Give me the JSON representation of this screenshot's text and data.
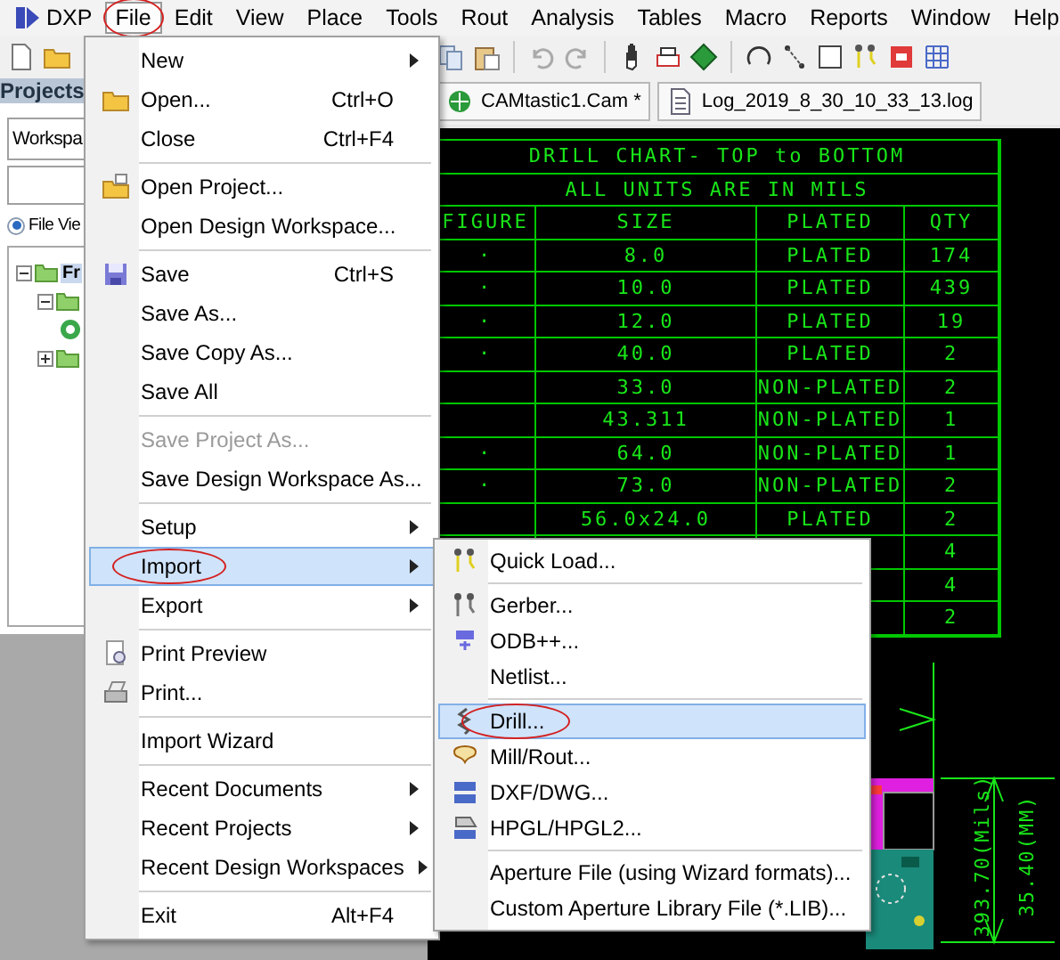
{
  "menubar": [
    {
      "label": "DXP",
      "kind": "logo",
      "selected": false,
      "highlighted": false
    },
    {
      "label": "File",
      "kind": "menu",
      "selected": true,
      "highlighted": true
    },
    {
      "label": "Edit",
      "kind": "menu",
      "selected": false,
      "highlighted": false
    },
    {
      "label": "View",
      "kind": "menu",
      "selected": false,
      "highlighted": false
    },
    {
      "label": "Place",
      "kind": "menu",
      "selected": false,
      "highlighted": false
    },
    {
      "label": "Tools",
      "kind": "menu",
      "selected": false,
      "highlighted": false
    },
    {
      "label": "Rout",
      "kind": "menu",
      "selected": false,
      "highlighted": false
    },
    {
      "label": "Analysis",
      "kind": "menu",
      "selected": false,
      "highlighted": false
    },
    {
      "label": "Tables",
      "kind": "menu",
      "selected": false,
      "highlighted": false
    },
    {
      "label": "Macro",
      "kind": "menu",
      "selected": false,
      "highlighted": false
    },
    {
      "label": "Reports",
      "kind": "menu",
      "selected": false,
      "highlighted": false
    },
    {
      "label": "Window",
      "kind": "menu",
      "selected": false,
      "highlighted": false
    },
    {
      "label": "Help",
      "kind": "menu",
      "selected": false,
      "highlighted": false
    }
  ],
  "left_panel": {
    "title": "Projects",
    "workspace": "Workspa",
    "view_option": {
      "label": "File Vie",
      "selected": true
    },
    "tree": [
      {
        "label": "Fr",
        "kind": "folder",
        "expanded": true,
        "children": [
          {
            "kind": "folder",
            "expanded": true,
            "children": [
              {
                "kind": "cam"
              }
            ]
          },
          {
            "kind": "folder",
            "expanded": false
          }
        ]
      }
    ]
  },
  "doc_tabs": [
    {
      "label": "CAMtastic1.Cam *",
      "kind": "cam"
    },
    {
      "label": "Log_2019_8_30_10_33_13.log",
      "kind": "log"
    }
  ],
  "drill_chart": {
    "title": "DRILL CHART- TOP to BOTTOM",
    "subtitle": "ALL UNITS ARE IN MILS",
    "columns": [
      "FIGURE",
      "SIZE",
      "PLATED",
      "QTY"
    ],
    "rows": [
      {
        "figure": "·",
        "size": "8.0",
        "plated": "PLATED",
        "qty": "174"
      },
      {
        "figure": "·",
        "size": "10.0",
        "plated": "PLATED",
        "qty": "439"
      },
      {
        "figure": "·",
        "size": "12.0",
        "plated": "PLATED",
        "qty": "19"
      },
      {
        "figure": "·",
        "size": "40.0",
        "plated": "PLATED",
        "qty": "2"
      },
      {
        "size": "33.0",
        "plated": "NON-PLATED",
        "qty": "2"
      },
      {
        "size": "43.311",
        "plated": "NON-PLATED",
        "qty": "1"
      },
      {
        "figure": "·",
        "size": "64.0",
        "plated": "NON-PLATED",
        "qty": "1"
      },
      {
        "figure": "·",
        "size": "73.0",
        "plated": "NON-PLATED",
        "qty": "2"
      },
      {
        "size": "56.0x24.0",
        "plated": "PLATED",
        "qty": "2"
      },
      {
        "qty": "4"
      },
      {
        "qty": "4"
      },
      {
        "qty": "2"
      }
    ]
  },
  "dimension": {
    "mils": "393.70(Mils)",
    "mm": "35.40(MM)"
  },
  "file_menu": [
    {
      "kind": "item",
      "label": "New",
      "submenu": true,
      "disabled": false,
      "selected": false,
      "highlighted": false
    },
    {
      "kind": "item",
      "label": "Open...",
      "shortcut": "Ctrl+O",
      "disabled": false,
      "selected": false,
      "highlighted": false
    },
    {
      "kind": "item",
      "label": "Close",
      "shortcut": "Ctrl+F4",
      "disabled": false,
      "selected": false,
      "highlighted": false
    },
    {
      "kind": "separator"
    },
    {
      "kind": "item",
      "label": "Open Project...",
      "disabled": false,
      "selected": false,
      "highlighted": false
    },
    {
      "kind": "item",
      "label": "Open Design Workspace...",
      "disabled": false,
      "selected": false,
      "highlighted": false
    },
    {
      "kind": "separator"
    },
    {
      "kind": "item",
      "label": "Save",
      "shortcut": "Ctrl+S",
      "disabled": false,
      "selected": false,
      "highlighted": false
    },
    {
      "kind": "item",
      "label": "Save As...",
      "disabled": false,
      "selected": false,
      "highlighted": false
    },
    {
      "kind": "item",
      "label": "Save Copy As...",
      "disabled": false,
      "selected": false,
      "highlighted": false
    },
    {
      "kind": "item",
      "label": "Save All",
      "disabled": false,
      "selected": false,
      "highlighted": false
    },
    {
      "kind": "separator"
    },
    {
      "kind": "item",
      "label": "Save Project As...",
      "disabled": true,
      "selected": false,
      "highlighted": false
    },
    {
      "kind": "item",
      "label": "Save Design Workspace As...",
      "disabled": false,
      "selected": false,
      "highlighted": false
    },
    {
      "kind": "separator"
    },
    {
      "kind": "item",
      "label": "Setup",
      "submenu": true,
      "disabled": false,
      "selected": false,
      "highlighted": false
    },
    {
      "kind": "item",
      "label": "Import",
      "submenu": true,
      "disabled": false,
      "selected": true,
      "highlighted": true
    },
    {
      "kind": "item",
      "label": "Export",
      "submenu": true,
      "disabled": false,
      "selected": false,
      "highlighted": false
    },
    {
      "kind": "separator"
    },
    {
      "kind": "item",
      "label": "Print Preview",
      "disabled": false,
      "selected": false,
      "highlighted": false
    },
    {
      "kind": "item",
      "label": "Print...",
      "disabled": false,
      "selected": false,
      "highlighted": false
    },
    {
      "kind": "separator"
    },
    {
      "kind": "item",
      "label": "Import Wizard",
      "disabled": false,
      "selected": false,
      "highlighted": false
    },
    {
      "kind": "separator"
    },
    {
      "kind": "item",
      "label": "Recent Documents",
      "submenu": true,
      "disabled": false,
      "selected": false,
      "highlighted": false
    },
    {
      "kind": "item",
      "label": "Recent Projects",
      "submenu": true,
      "disabled": false,
      "selected": false,
      "highlighted": false
    },
    {
      "kind": "item",
      "label": "Recent Design Workspaces",
      "submenu": true,
      "disabled": false,
      "selected": false,
      "highlighted": false
    },
    {
      "kind": "separator"
    },
    {
      "kind": "item",
      "label": "Exit",
      "shortcut": "Alt+F4",
      "disabled": false,
      "selected": false,
      "highlighted": false
    }
  ],
  "import_submenu": [
    {
      "kind": "item",
      "label": "Quick Load...",
      "selected": false,
      "highlighted": false
    },
    {
      "kind": "separator"
    },
    {
      "kind": "item",
      "label": "Gerber...",
      "selected": false,
      "highlighted": false
    },
    {
      "kind": "item",
      "label": "ODB++...",
      "selected": false,
      "highlighted": false
    },
    {
      "kind": "item",
      "label": "Netlist...",
      "selected": false,
      "highlighted": false
    },
    {
      "kind": "separator"
    },
    {
      "kind": "item",
      "label": "Drill...",
      "selected": true,
      "highlighted": true
    },
    {
      "kind": "item",
      "label": "Mill/Rout...",
      "selected": false,
      "highlighted": false
    },
    {
      "kind": "item",
      "label": "DXF/DWG...",
      "selected": false,
      "highlighted": false
    },
    {
      "kind": "item",
      "label": "HPGL/HPGL2...",
      "selected": false,
      "highlighted": false
    },
    {
      "kind": "separator"
    },
    {
      "kind": "item",
      "label": "Aperture File (using Wizard formats)...",
      "selected": false,
      "highlighted": false
    },
    {
      "kind": "item",
      "label": "Custom Aperture Library File (*.LIB)...",
      "selected": false,
      "highlighted": false
    }
  ]
}
